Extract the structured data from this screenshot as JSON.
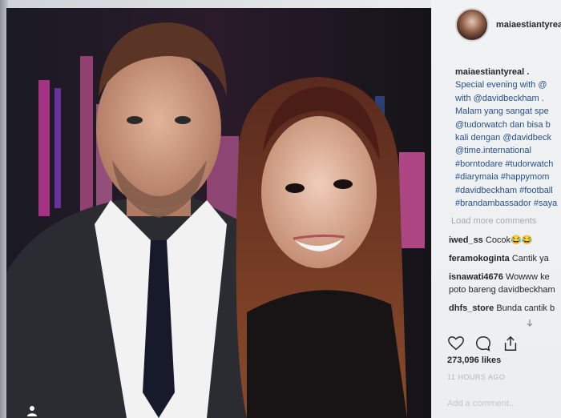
{
  "post": {
    "username": "maiaestiantyreal",
    "caption": {
      "username": "maiaestiantyreal .",
      "lines": [
        "Special evening with @",
        "with @davidbeckham .",
        "Malam yang sangat spe",
        "@tudorwatch dan bisa b",
        "kali dengan @davidbeck",
        "@time.international",
        "#borntodare #tudorwatch",
        "#diarymaia #happymom",
        "#davidbeckham #football",
        "#brandambassador #saya"
      ]
    },
    "load_more": "Load more comments",
    "comments": [
      {
        "user": "iwed_ss",
        "text": "Cocok😂😂"
      },
      {
        "user": "feramokoginta",
        "text": "Cantik ya"
      },
      {
        "user": "isnawati4676",
        "text": "Wowww ke",
        "text2": "poto bareng davidbeckham"
      },
      {
        "user": "dhfs_store",
        "text": "Bunda cantik b"
      }
    ],
    "likes": "273,096 likes",
    "time_ago": "11 HOURS AGO",
    "add_comment": "Add a comment..."
  },
  "icons": {
    "like": "heart-icon",
    "comment": "comment-icon",
    "share": "share-icon"
  },
  "colors": {
    "hashtag": "#26508a",
    "text": "#262626",
    "muted": "#a8a8a8"
  }
}
